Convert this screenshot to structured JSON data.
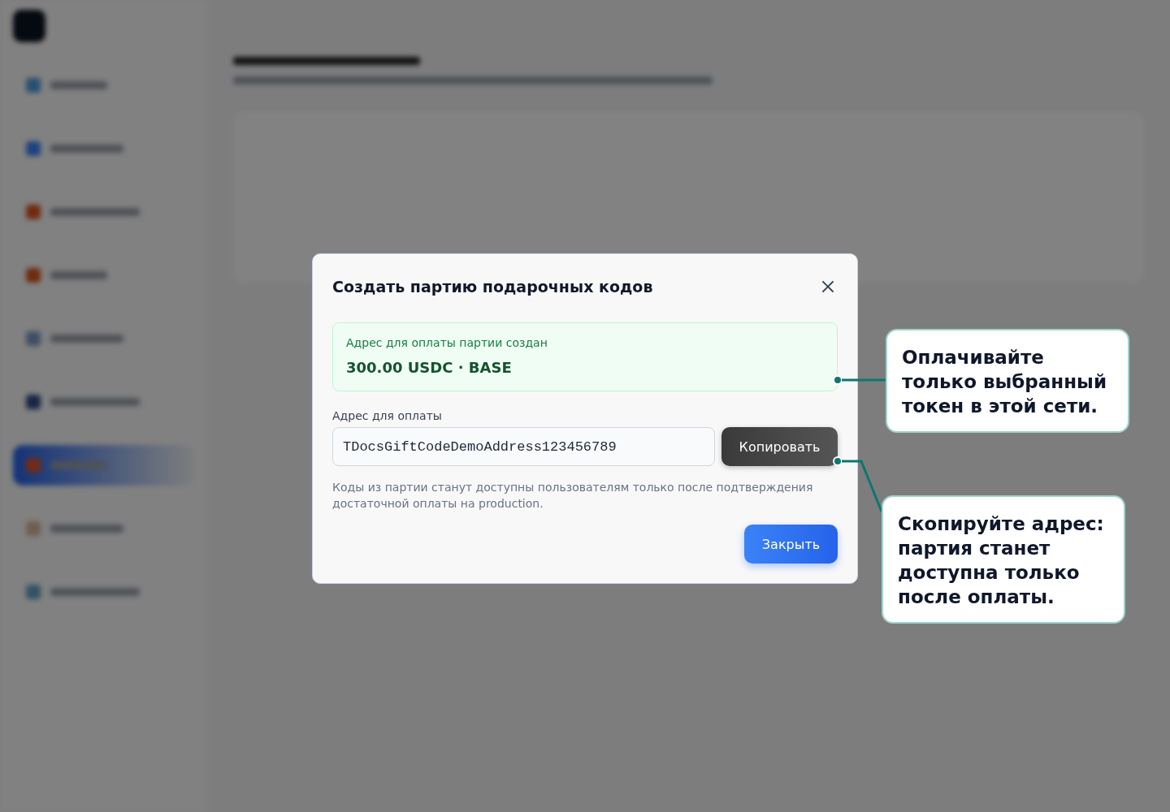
{
  "modal": {
    "title": "Создать партию подарочных кодов",
    "notice": {
      "label": "Адрес для оплаты партии создан",
      "amount": "300.00 USDC · BASE"
    },
    "address": {
      "label": "Адрес для оплаты",
      "value": "TDocsGiftCodeDemoAddress123456789"
    },
    "copy_button": "Копировать",
    "hint": "Коды из партии станут доступны пользователям только после подтверждения достаточной оплаты на production.",
    "close_button": "Закрыть"
  },
  "callouts": [
    {
      "text": "Оплачивайте только выбранный токен в этой сети."
    },
    {
      "text": "Скопируйте адрес: партия станет доступна только после оплаты."
    }
  ]
}
